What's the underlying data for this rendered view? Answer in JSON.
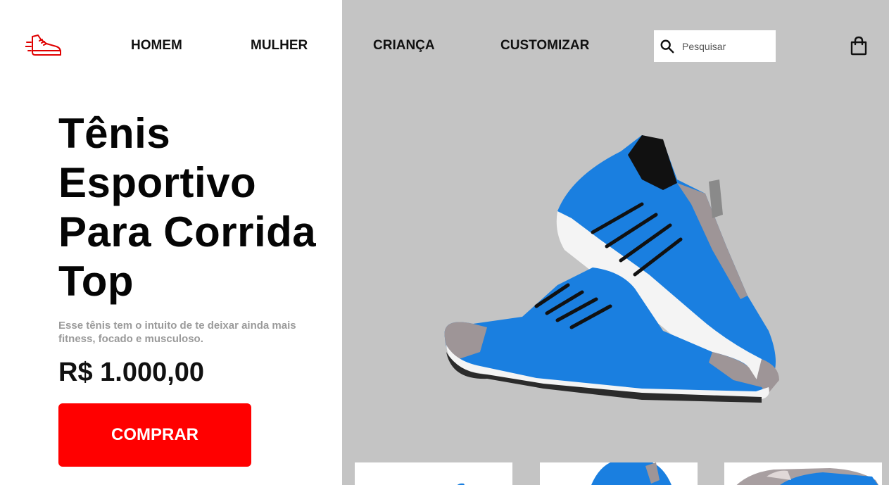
{
  "nav": {
    "logo_icon": "running-shoe-icon",
    "items": [
      {
        "label": "HOMEM"
      },
      {
        "label": "MULHER"
      },
      {
        "label": "CRIANÇA"
      },
      {
        "label": "CUSTOMIZAR"
      }
    ],
    "search": {
      "placeholder": "Pesquisar",
      "value": "",
      "icon": "search-icon"
    },
    "bag_icon": "shopping-bag-icon"
  },
  "product": {
    "title": "Tênis Esportivo Para Corrida Top",
    "description": "Esse tênis tem o intuito de te deixar ainda mais fitness, focado e musculoso.",
    "price": "R$ 1.000,00",
    "buy_label": "COMPRAR"
  },
  "colors": {
    "accent": "#ff0000",
    "panel": "#c4c4c4",
    "shoe_blue": "#1a7fe0"
  }
}
